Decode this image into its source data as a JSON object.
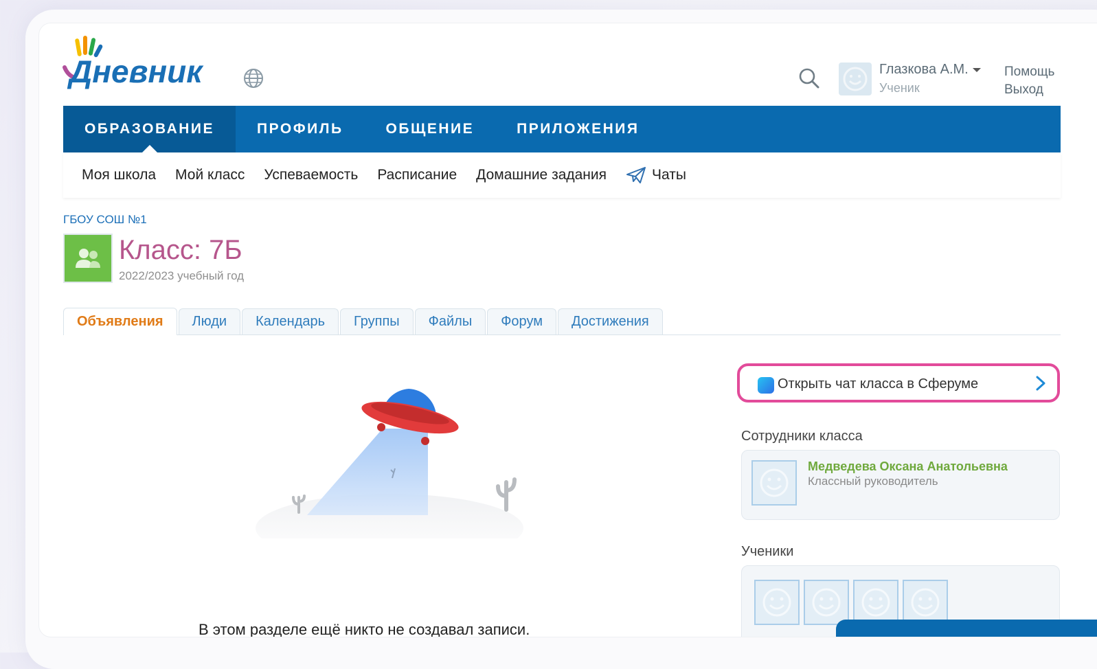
{
  "header": {
    "logo_text": "Дневник",
    "user_name": "Глазкова А.М.",
    "user_role": "Ученик",
    "help_link": "Помощь",
    "logout_link": "Выход"
  },
  "main_nav": {
    "items": [
      "ОБРАЗОВАНИЕ",
      "ПРОФИЛЬ",
      "ОБЩЕНИЕ",
      "ПРИЛОЖЕНИЯ"
    ],
    "active": "ОБРАЗОВАНИЕ"
  },
  "sub_nav": {
    "items": [
      "Моя школа",
      "Мой класс",
      "Успеваемость",
      "Расписание",
      "Домашние задания",
      "Чаты"
    ]
  },
  "school": {
    "name": "ГБОУ СОШ №1"
  },
  "class_info": {
    "title": "Класс: 7Б",
    "year": "2022/2023 учебный год"
  },
  "tabs": {
    "items": [
      "Объявления",
      "Люди",
      "Календарь",
      "Группы",
      "Файлы",
      "Форум",
      "Достижения"
    ],
    "active": "Объявления"
  },
  "main": {
    "empty_message": "В этом разделе ещё никто не создавал записи."
  },
  "sidebar": {
    "chat_button_label": "Открыть чат класса в Сферуме",
    "staff_heading": "Сотрудники класса",
    "staff": [
      {
        "name": "Медведева Оксана Анатольевна",
        "role": "Классный руководитель"
      }
    ],
    "pupils_heading": "Ученики"
  },
  "colors": {
    "nav_blue": "#0a6aaf",
    "nav_active": "#075a96",
    "class_title": "#b6568c",
    "tab_active": "#e07b17",
    "highlight_border": "#e24b9a",
    "staff_name": "#6fa93d"
  }
}
